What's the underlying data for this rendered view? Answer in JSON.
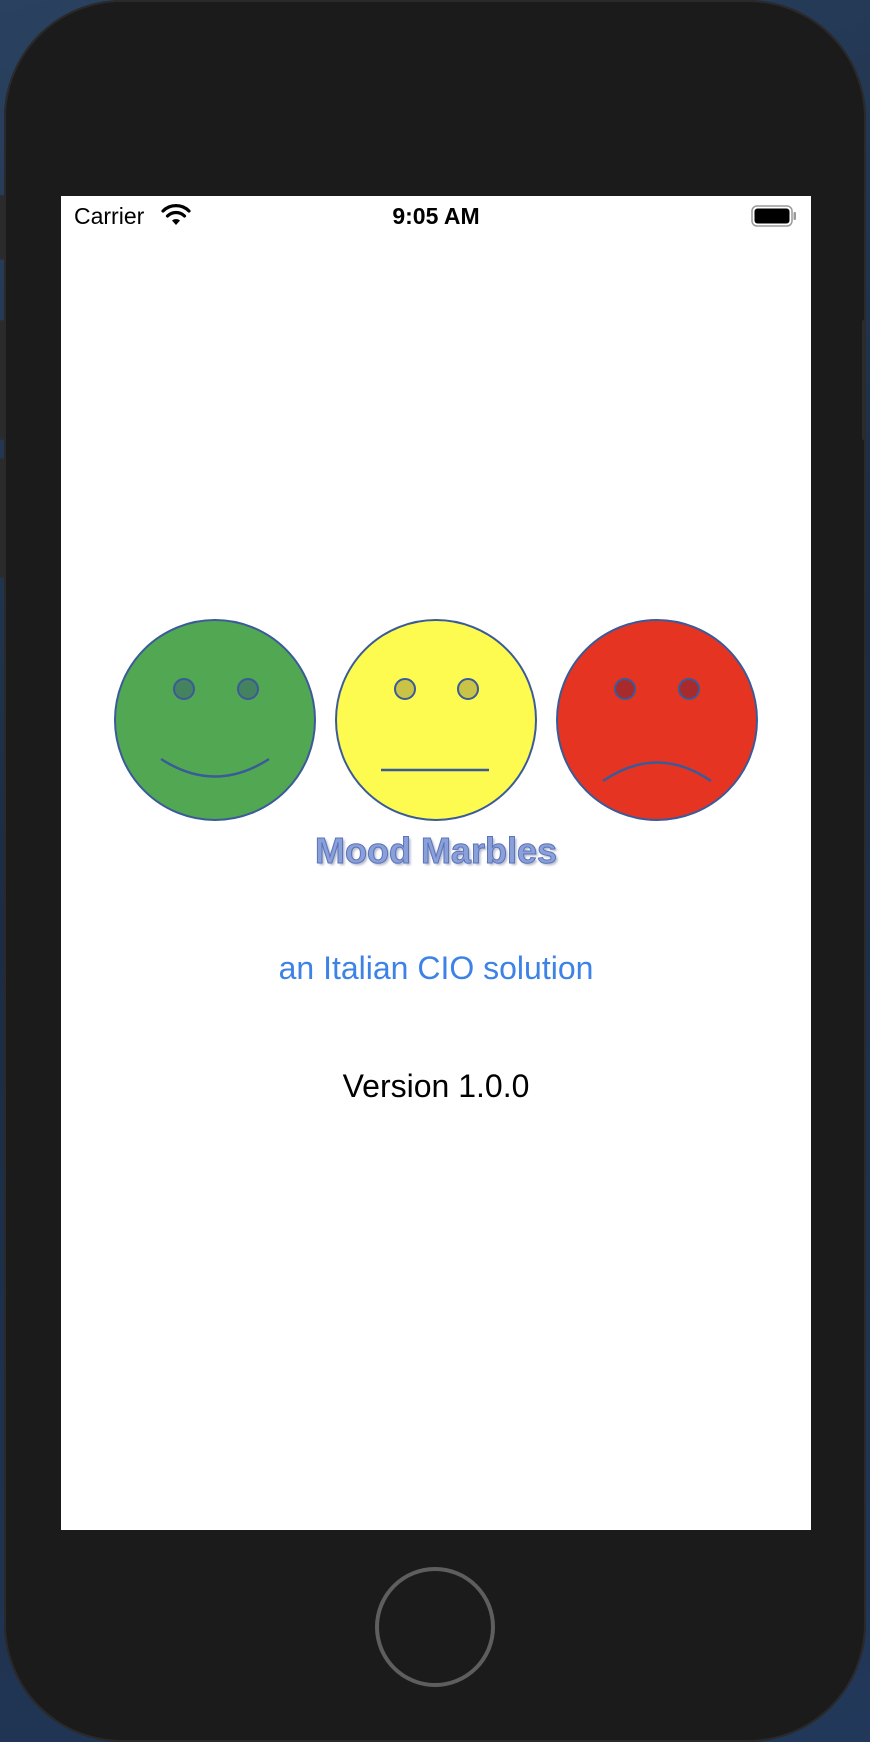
{
  "status_bar": {
    "carrier": "Carrier",
    "time": "9:05 AM"
  },
  "logo": {
    "faces": [
      {
        "mood": "happy",
        "color": "#52a852",
        "eye_color": "#45825f"
      },
      {
        "mood": "neutral",
        "color": "#fdfb50",
        "eye_color": "#c9c445"
      },
      {
        "mood": "sad",
        "color": "#e63423",
        "eye_color": "#a92a2a"
      }
    ],
    "outline_color": "#3a5a99"
  },
  "app": {
    "title": "Mood Marbles",
    "subtitle": "an Italian CIO solution",
    "version": "Version 1.0.0"
  },
  "colors": {
    "subtitle": "#3d82e6",
    "title": "#8aa0da"
  }
}
